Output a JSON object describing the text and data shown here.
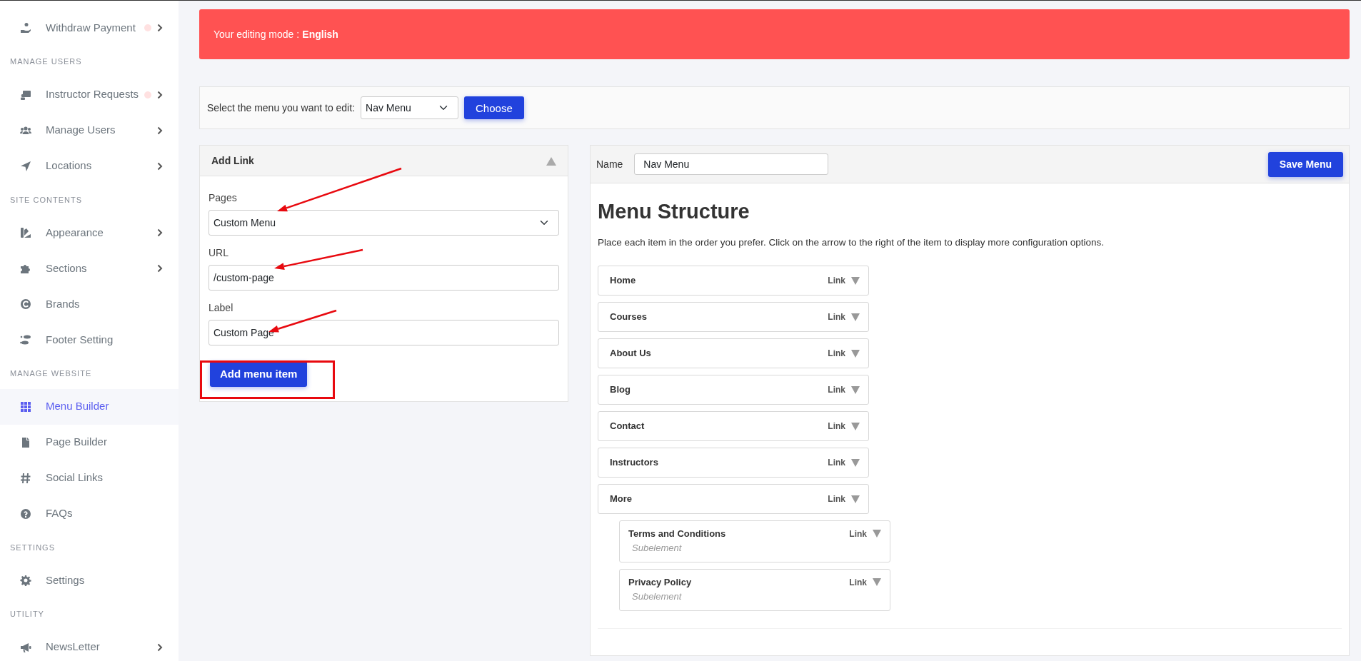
{
  "sidebar": {
    "sections": [
      {
        "items": [
          {
            "label": "Withdraw Payment",
            "has_submenu": true,
            "dot": true,
            "selected": false
          }
        ]
      },
      {
        "heading": "MANAGE USERS",
        "items": [
          {
            "label": "Instructor Requests",
            "has_submenu": true,
            "dot": true,
            "selected": false
          },
          {
            "label": "Manage Users",
            "has_submenu": true,
            "dot": false,
            "selected": false
          },
          {
            "label": "Locations",
            "has_submenu": true,
            "dot": false,
            "selected": false
          }
        ]
      },
      {
        "heading": "SITE CONTENTS",
        "items": [
          {
            "label": "Appearance",
            "has_submenu": true,
            "dot": false,
            "selected": false
          },
          {
            "label": "Sections",
            "has_submenu": true,
            "dot": false,
            "selected": false
          },
          {
            "label": "Brands",
            "has_submenu": false,
            "dot": false,
            "selected": false
          },
          {
            "label": "Footer Setting",
            "has_submenu": false,
            "dot": false,
            "selected": false
          }
        ]
      },
      {
        "heading": "MANAGE WEBSITE",
        "items": [
          {
            "label": "Menu Builder",
            "has_submenu": false,
            "dot": false,
            "selected": true
          },
          {
            "label": "Page Builder",
            "has_submenu": false,
            "dot": false,
            "selected": false
          },
          {
            "label": "Social Links",
            "has_submenu": false,
            "dot": false,
            "selected": false
          },
          {
            "label": "FAQs",
            "has_submenu": false,
            "dot": false,
            "selected": false
          }
        ]
      },
      {
        "heading": "SETTINGS",
        "items": [
          {
            "label": "Settings",
            "has_submenu": false,
            "dot": false,
            "selected": false
          }
        ]
      },
      {
        "heading": "UTILITY",
        "items": [
          {
            "label": "NewsLetter",
            "has_submenu": true,
            "dot": false,
            "selected": false
          }
        ]
      }
    ]
  },
  "alert": {
    "text": "Your editing mode : **English**"
  },
  "menu_picker": {
    "label": "Select the menu you want to edit:",
    "value": "Nav Menu",
    "button": "Choose"
  },
  "add_link": {
    "title": "Add Link",
    "expanded": true,
    "fields": [
      {
        "kind": "select",
        "label": "Pages",
        "value": "Custom Menu"
      },
      {
        "kind": "text",
        "label": "URL",
        "value": "/custom-page"
      },
      {
        "kind": "text",
        "label": "Label",
        "value": "Custom Page"
      }
    ],
    "button": "Add menu item"
  },
  "menu_editor": {
    "name_label": "Name",
    "name_value": "Nav Menu",
    "save_button": "Save Menu",
    "heading": "Menu Structure",
    "description": "Place each item in the order you prefer. Click on the arrow to the right of the item to display more configuration options.",
    "items": [
      {
        "label": "Home",
        "type": "Link"
      },
      {
        "label": "Courses",
        "type": "Link"
      },
      {
        "label": "About Us",
        "type": "Link"
      },
      {
        "label": "Blog",
        "type": "Link"
      },
      {
        "label": "Contact",
        "type": "Link"
      },
      {
        "label": "Instructors",
        "type": "Link"
      },
      {
        "label": "More",
        "type": "Link",
        "children": [
          {
            "label": "Terms and Conditions",
            "type": "Link",
            "note": "Subelement"
          },
          {
            "label": "Privacy Policy",
            "type": "Link",
            "note": "Subelement"
          }
        ]
      }
    ]
  }
}
